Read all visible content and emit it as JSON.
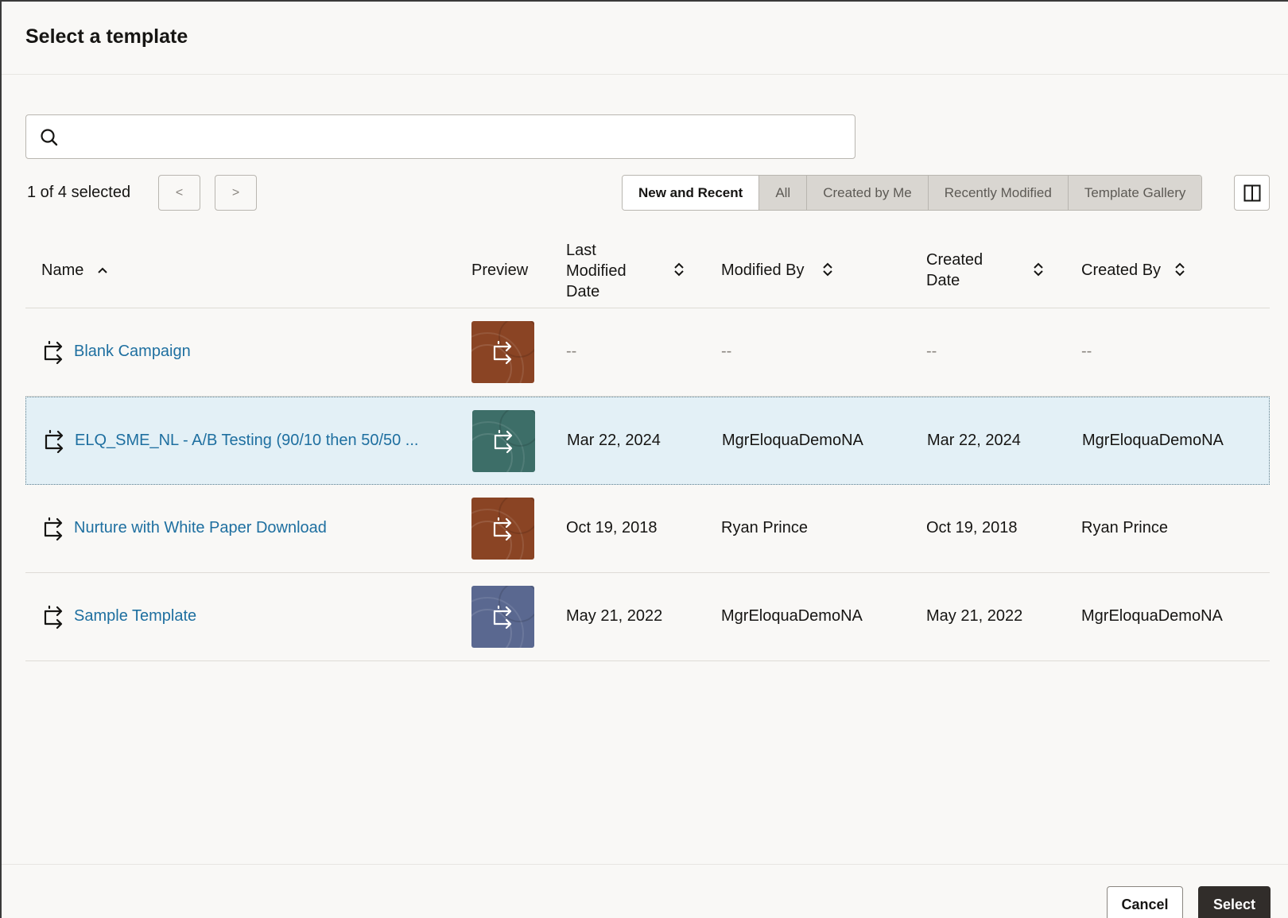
{
  "dialog": {
    "title": "Select a template"
  },
  "search": {
    "value": "",
    "placeholder": ""
  },
  "toolbar": {
    "selected_count": "1 of 4 selected",
    "prev_label": "<",
    "next_label": ">",
    "filters": [
      "New and Recent",
      "All",
      "Created by Me",
      "Recently Modified",
      "Template Gallery"
    ],
    "active_filter": "New and Recent"
  },
  "table": {
    "headers": {
      "name": "Name",
      "preview": "Preview",
      "last_modified_1": "Last",
      "last_modified_2": "Modified",
      "last_modified_3": "Date",
      "modified_by": "Modified By",
      "created_date_1": "Created",
      "created_date_2": "Date",
      "created_by": "Created By"
    },
    "rows": [
      {
        "name": "Blank Campaign",
        "thumb_color": "#8a4424",
        "last_modified": "--",
        "modified_by": "--",
        "created_date": "--",
        "created_by": "--",
        "selected": false
      },
      {
        "name": "ELQ_SME_NL - A/B Testing (90/10 then 50/50 ...",
        "thumb_color": "#3d6e68",
        "last_modified": "Mar 22, 2024",
        "modified_by": "MgrEloquaDemoNA",
        "created_date": "Mar 22, 2024",
        "created_by": "MgrEloquaDemoNA",
        "selected": true
      },
      {
        "name": "Nurture with White Paper Download",
        "thumb_color": "#8a4424",
        "last_modified": "Oct 19, 2018",
        "modified_by": "Ryan Prince",
        "created_date": "Oct 19, 2018",
        "created_by": "Ryan Prince",
        "selected": false
      },
      {
        "name": "Sample Template",
        "thumb_color": "#5a6890",
        "last_modified": "May 21, 2022",
        "modified_by": "MgrEloquaDemoNA",
        "created_date": "May 21, 2022",
        "created_by": "MgrEloquaDemoNA",
        "selected": false
      }
    ]
  },
  "footer": {
    "cancel_label": "Cancel",
    "select_label": "Select"
  },
  "colors": {
    "link": "#1e6fa0",
    "selected_row": "#e3f0f6",
    "primary_button": "#312d2a"
  },
  "icons": {
    "search": "search-icon",
    "columns": "split-columns-icon",
    "campaign": "campaign-flow-icon",
    "sort": "sort-icon"
  }
}
